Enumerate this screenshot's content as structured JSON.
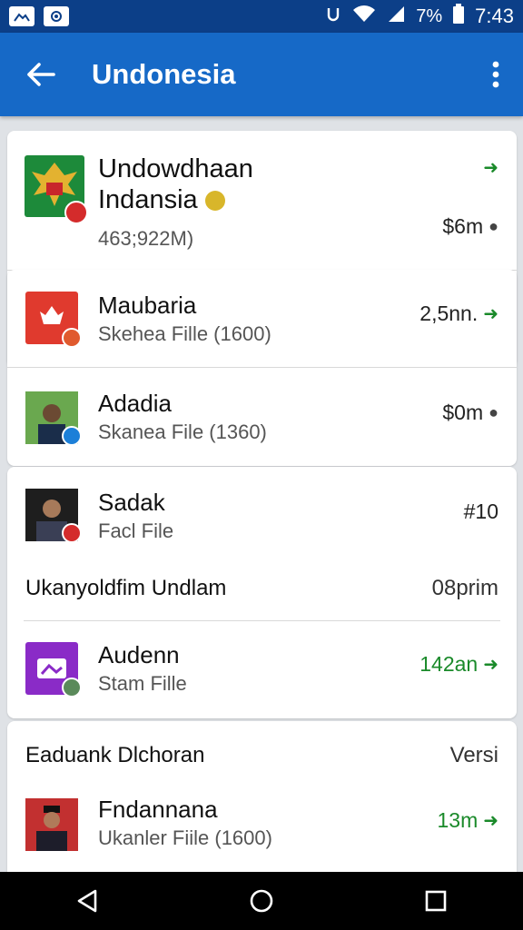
{
  "status_bar": {
    "left_icons": [
      "image-icon",
      "shield-icon"
    ],
    "battery": "7%",
    "time": "7:43"
  },
  "app_bar": {
    "title": "Undonesia"
  },
  "cards": [
    {
      "rows": [
        {
          "title_line1": "Undowdhaan",
          "title_line2": "Indansia",
          "subtitle": "463;922M)",
          "amount": "$6m",
          "trailing": "pin",
          "top_arrow": true,
          "thumb_color": "#1d8a3a",
          "badge_color": "#d42b2b"
        }
      ]
    },
    {
      "rows": [
        {
          "title": "Maubaria",
          "subtitle": "Skehea Fille (1600)",
          "amount": "2,5nn.",
          "trailing": "arrow",
          "thumb_color": "#e03a2e",
          "badge_color": "#e05a2e"
        },
        {
          "title": "Adadia",
          "subtitle": "Skanea File (1360)",
          "amount": "$0m",
          "trailing": "pin",
          "thumb_color": "#2d6d3a",
          "badge_color": "#1c7fd8"
        }
      ]
    },
    {
      "rows": [
        {
          "title": "Sadak",
          "subtitle": "Facl File",
          "amount": "#10",
          "trailing": "none",
          "thumb_color": "#2b2b2b",
          "badge_color": "#d42b2b"
        }
      ],
      "section": {
        "label": "Ukanyoldfim Undlam",
        "right": "08prim"
      },
      "rows_after": [
        {
          "title": "Audenn",
          "subtitle": "Stam Fille",
          "amount": "142an",
          "trailing": "arrow",
          "green": true,
          "thumb_color": "#8a2bc7",
          "badge_color": "#5a8a5a"
        }
      ]
    },
    {
      "section": {
        "label": "Eaduank Dlchoran",
        "right": "Versi"
      },
      "rows_after": [
        {
          "title": "Fndannana",
          "subtitle": "Ukanler Fiile (1600)",
          "amount": "13m",
          "trailing": "arrow",
          "green": true,
          "thumb_color": "#b82525",
          "badge_color": "#d42b2b"
        }
      ]
    }
  ],
  "colors": {
    "status_bar": "#0c3f88",
    "app_bar": "#1669c7",
    "accent_green": "#1a8a2a",
    "background": "#dfe2e6"
  }
}
